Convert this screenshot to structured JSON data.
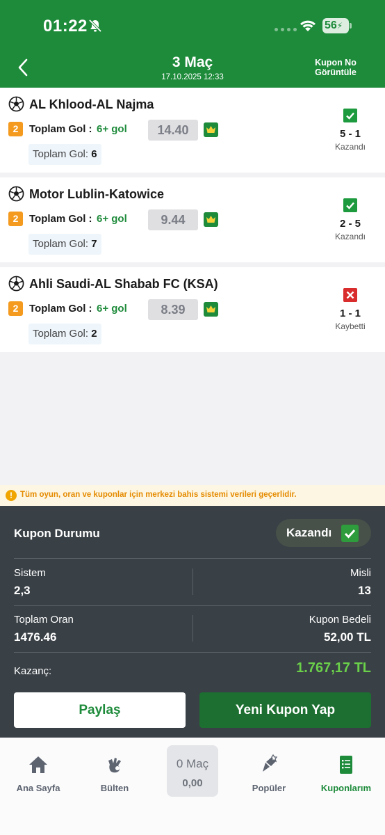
{
  "status_bar": {
    "time": "01:22",
    "battery": "56"
  },
  "header": {
    "title": "3 Maç",
    "subtitle": "17.10.2025 12:33",
    "kupon_no_line1": "Kupon No",
    "kupon_no_line2": "Görüntüle"
  },
  "matches": [
    {
      "teams": "AL Khlood-AL Najma",
      "bet_num": "2",
      "bet_label": "Toplam Gol :",
      "bet_value": "6+ gol",
      "odds": "14.40",
      "result_label": "Toplam Gol:",
      "result_value": "6",
      "score": "5 - 1",
      "status": "Kazandı"
    },
    {
      "teams": "Motor Lublin-Katowice",
      "bet_num": "2",
      "bet_label": "Toplam Gol :",
      "bet_value": "6+ gol",
      "odds": "9.44",
      "result_label": "Toplam Gol:",
      "result_value": "7",
      "score": "2 - 5",
      "status": "Kazandı"
    },
    {
      "teams": "Ahli Saudi-AL Shabab FC (KSA)",
      "bet_num": "2",
      "bet_label": "Toplam Gol :",
      "bet_value": "6+ gol",
      "odds": "8.39",
      "result_label": "Toplam Gol:",
      "result_value": "2",
      "score": "1 - 1",
      "status": "Kaybetti"
    }
  ],
  "notice": {
    "icon": "!",
    "text": "Tüm oyun, oran ve kuponlar için merkezi bahis sistemi verileri geçerlidir."
  },
  "summary": {
    "title": "Kupon Durumu",
    "status": "Kazandı",
    "sistem_label": "Sistem",
    "sistem_value": "2,3",
    "misli_label": "Misli",
    "misli_value": "13",
    "toplam_oran_label": "Toplam Oran",
    "toplam_oran_value": "1476.46",
    "kupon_bedeli_label": "Kupon Bedeli",
    "kupon_bedeli_value": "52,00 TL",
    "kazanc_label": "Kazanç:",
    "kazanc_value": "1.767,17 TL",
    "share_label": "Paylaş",
    "new_label": "Yeni Kupon Yap"
  },
  "tabbar": {
    "home": "Ana Sayfa",
    "bulten": "Bülten",
    "center_top": "0 Maç",
    "center_bottom": "0,00",
    "populer": "Popüler",
    "kuponlarim": "Kuponlarım"
  },
  "colors": {
    "brand_green": "#1e8b3b",
    "win_green": "#1e9a3e",
    "lose_red": "#d92c2c",
    "odds_orange": "#f49a1f",
    "panel_dark": "#394046",
    "winnings_green": "#6ad04a"
  }
}
